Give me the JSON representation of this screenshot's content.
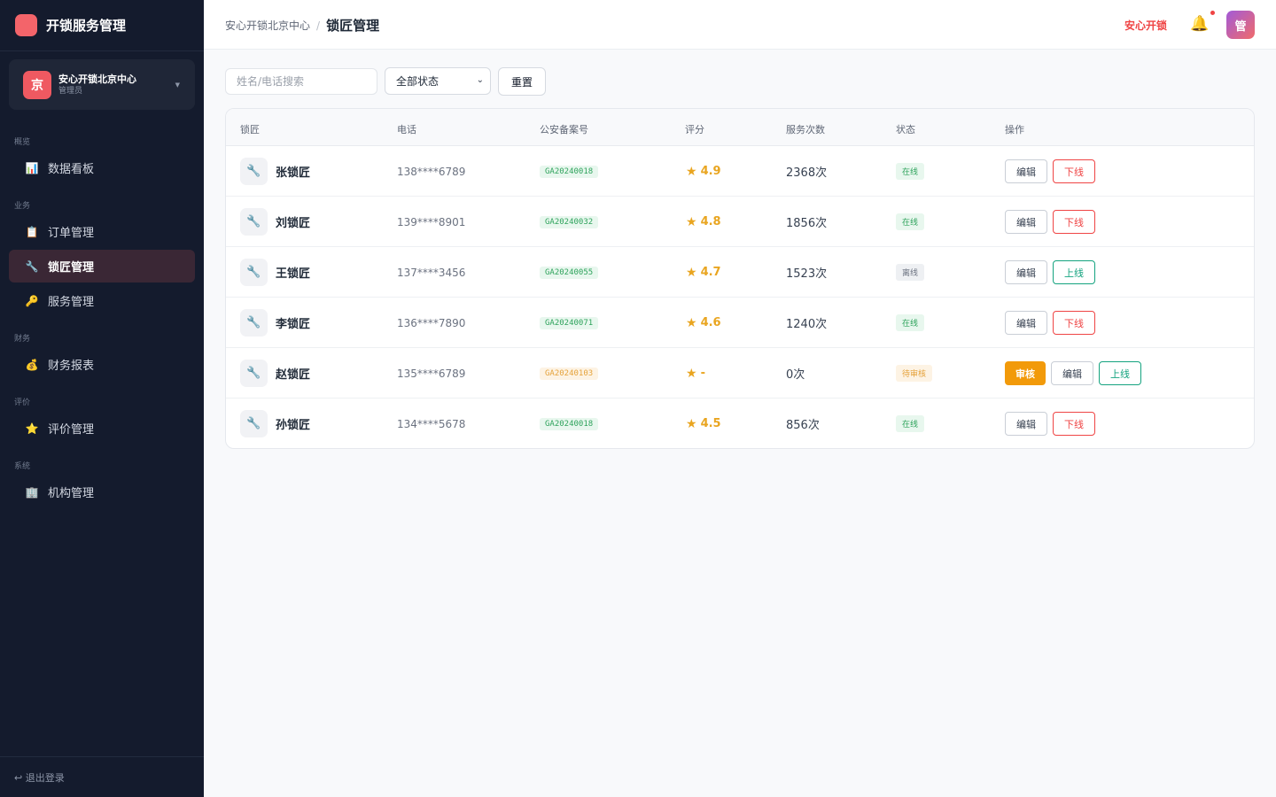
{
  "sidebar": {
    "brand": "开锁服务管理",
    "org": {
      "avatar": "京",
      "name": "安心开锁北京中心",
      "role": "管理员"
    },
    "groups": [
      "概览",
      "业务",
      "财务",
      "评价",
      "系统"
    ],
    "items": [
      {
        "label": "数据看板",
        "icon": "chart-icon",
        "glyph": "📊"
      },
      {
        "label": "订单管理",
        "icon": "clipboard-icon",
        "glyph": "📋"
      },
      {
        "label": "锁匠管理",
        "icon": "wrench-icon",
        "glyph": "🔧"
      },
      {
        "label": "服务管理",
        "icon": "key-icon",
        "glyph": "🔑"
      },
      {
        "label": "财务报表",
        "icon": "money-bag-icon",
        "glyph": "💰"
      },
      {
        "label": "评价管理",
        "icon": "star-icon",
        "glyph": "⭐"
      },
      {
        "label": "机构管理",
        "icon": "building-icon",
        "glyph": "🏢"
      }
    ],
    "logout": "↩ 退出登录"
  },
  "header": {
    "breadcrumb_parent": "安心开锁北京中心",
    "breadcrumb_sep": "/",
    "breadcrumb_current": "锁匠管理",
    "brand_link": "安心开锁",
    "bell_glyph": "🔔",
    "avatar": "管"
  },
  "filters": {
    "search_placeholder": "姓名/电话搜索",
    "status_value": "全部状态",
    "reset": "重置"
  },
  "table": {
    "columns": [
      "锁匠",
      "电话",
      "公安备案号",
      "评分",
      "服务次数",
      "状态",
      "操作"
    ],
    "rows": [
      {
        "name": "张锁匠",
        "phone": "138****6789",
        "record_no": "GA20240018",
        "record_state": "ok",
        "score": "4.9",
        "count": "2368次",
        "status": "在线",
        "status_type": "online",
        "actions": [
          "编辑",
          "下线"
        ]
      },
      {
        "name": "刘锁匠",
        "phone": "139****8901",
        "record_no": "GA20240032",
        "record_state": "ok",
        "score": "4.8",
        "count": "1856次",
        "status": "在线",
        "status_type": "online",
        "actions": [
          "编辑",
          "下线"
        ]
      },
      {
        "name": "王锁匠",
        "phone": "137****3456",
        "record_no": "GA20240055",
        "record_state": "ok",
        "score": "4.7",
        "count": "1523次",
        "status": "离线",
        "status_type": "offline",
        "actions": [
          "编辑",
          "上线"
        ]
      },
      {
        "name": "李锁匠",
        "phone": "136****7890",
        "record_no": "GA20240071",
        "record_state": "ok",
        "score": "4.6",
        "count": "1240次",
        "status": "在线",
        "status_type": "online",
        "actions": [
          "编辑",
          "下线"
        ]
      },
      {
        "name": "赵锁匠",
        "phone": "135****6789",
        "record_no": "GA20240103",
        "record_state": "pending",
        "score": "-",
        "count": "0次",
        "status": "待审核",
        "status_type": "review",
        "actions": [
          "审核",
          "编辑",
          "上线"
        ]
      },
      {
        "name": "孙锁匠",
        "phone": "134****5678",
        "record_no": "GA20240018",
        "record_state": "ok",
        "score": "4.5",
        "count": "856次",
        "status": "在线",
        "status_type": "online",
        "actions": [
          "编辑",
          "下线"
        ]
      }
    ]
  },
  "colors": {
    "sidebar_bg": "#141b2d",
    "active_item_bg": "#3a2735",
    "accent_red": "#ef4444",
    "star": "#e9a520",
    "online": "#2fa35c",
    "review_btn": "#f29a0a",
    "up_btn": "#14a37f"
  }
}
